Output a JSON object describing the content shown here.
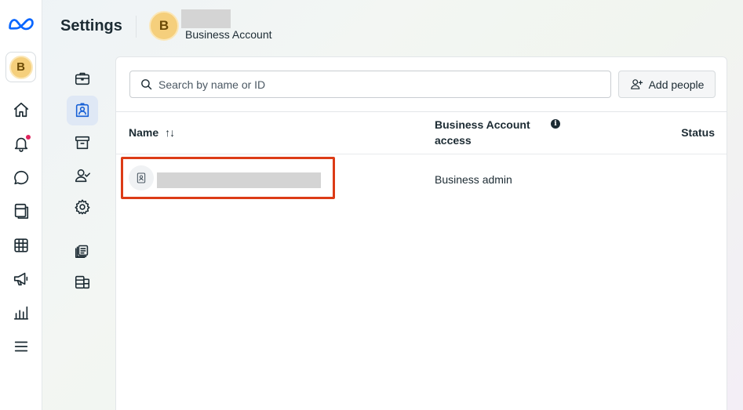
{
  "header": {
    "title": "Settings",
    "account_initial": "B",
    "account_subtitle": "Business Account"
  },
  "rail": {
    "account_initial": "B",
    "icons": [
      "home-icon",
      "notifications-icon",
      "messages-icon",
      "pages-icon",
      "table-icon",
      "megaphone-icon",
      "analytics-icon",
      "menu-icon"
    ],
    "notification_dot": true
  },
  "subnav": {
    "icons": [
      "briefcase-icon",
      "people-badge-icon",
      "archive-icon",
      "user-check-icon",
      "gear-icon",
      "library-icon",
      "database-icon"
    ],
    "active": "people-badge-icon"
  },
  "search": {
    "placeholder": "Search by name or ID"
  },
  "actions": {
    "add_people_label": "Add people"
  },
  "table": {
    "columns": {
      "name": "Name",
      "sort_indicator": "↑↓",
      "access": "Business Account access",
      "status": "Status"
    },
    "rows": [
      {
        "name": "",
        "access": "Business admin",
        "status": ""
      }
    ]
  },
  "colors": {
    "accent": "#1760d6",
    "highlight": "#dc3b16",
    "avatar": "#f5cf7c"
  }
}
